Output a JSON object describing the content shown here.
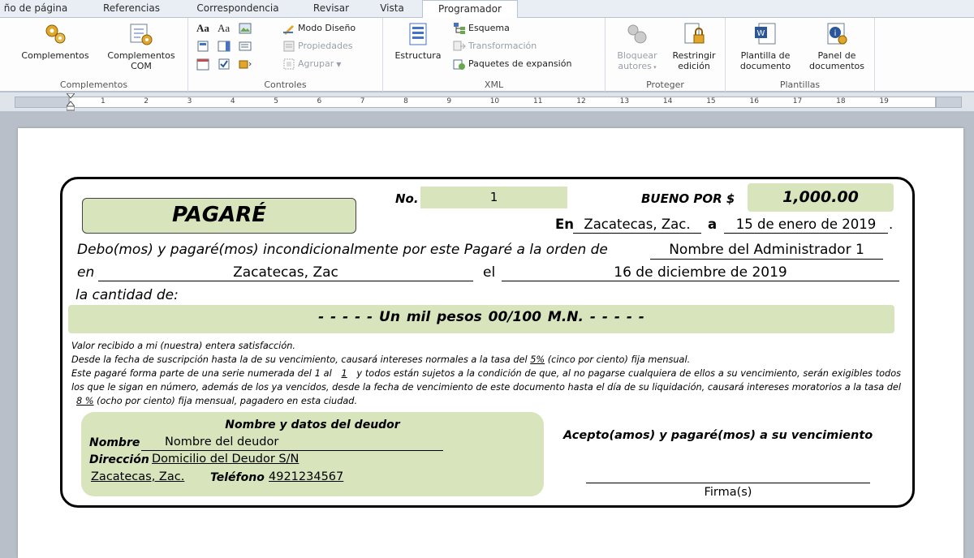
{
  "tabs": [
    "ño de página",
    "Referencias",
    "Correspondencia",
    "Revisar",
    "Vista",
    "Programador"
  ],
  "ribbon": {
    "complementos": {
      "btn1": "Complementos",
      "btn2a": "Complementos",
      "btn2b": "COM",
      "label": "Complementos"
    },
    "controles": {
      "modo": "Modo Diseño",
      "propiedades": "Propiedades",
      "agrupar": "Agrupar",
      "label": "Controles",
      "aa1": "Aa",
      "aa2": "Aa"
    },
    "xml": {
      "estructura": "Estructura",
      "esquema": "Esquema",
      "transformacion": "Transformación",
      "paquetes": "Paquetes de expansión",
      "label": "XML"
    },
    "proteger": {
      "bloquear_a": "Bloquear",
      "bloquear_b": "autores",
      "restringir_a": "Restringir",
      "restringir_b": "edición",
      "label": "Proteger"
    },
    "plantillas": {
      "plantilla_a": "Plantilla de",
      "plantilla_b": "documento",
      "panel_a": "Panel de",
      "panel_b": "documentos",
      "label": "Plantillas"
    }
  },
  "ruler": [
    "1",
    "2",
    "3",
    "4",
    "5",
    "6",
    "7",
    "8",
    "9",
    "10",
    "11",
    "12",
    "13",
    "14",
    "15",
    "16",
    "17",
    "18",
    "19"
  ],
  "doc": {
    "title": "PAGARÉ",
    "no_label": "No.",
    "no_value": "1",
    "bueno_label": "BUENO POR $",
    "amount": "1,000.00",
    "en_label": "En",
    "city": "Zacatecas, Zac.",
    "a_label": "a",
    "date": "15 de enero de 2019",
    "date_end": ".",
    "debo_text": "Debo(mos) y pagaré(mos) incondicionalmente por este Pagaré a la orden de",
    "payee": "Nombre del Administrador 1",
    "en2_label": "en",
    "place": "Zacatecas, Zac",
    "el_label": "el",
    "due_date": "16 de diciembre de 2019",
    "cantidad_label": "la cantidad de:",
    "amount_words": "- - - - - Un mil pesos 00/100 M.N. - - - - -",
    "p1": "Valor recibido a mi (nuestra) entera satisfacción.",
    "p2a": "Desde la fecha de suscripción hasta la de su vencimiento, causará intereses normales a la tasa del ",
    "p2b": "5%",
    "p2c": " (cinco por ciento) fija mensual.",
    "p3a": "Este pagaré forma parte de una serie numerada del 1 al ",
    "p3b": "1",
    "p3c": " y todos están sujetos a la condición de que, al no pagarse cualquiera de ellos a su vencimiento, serán exigibles todos los que le sigan en número, además de los ya vencidos, desde la fecha de vencimiento de este documento hasta el día de su liquidación, causará intereses moratorios a la tasa del ",
    "p3d": "8 %",
    "p3e": " (ocho por ciento) fija mensual, pagadero en esta ciudad.",
    "deudor_title": "Nombre y datos del deudor",
    "nombre_label": "Nombre",
    "nombre_value": "Nombre del deudor",
    "direccion_label": "Dirección",
    "direccion_value": "Domicilio del Deudor S/N",
    "ciudad_value": "Zacatecas, Zac.",
    "telefono_label": "Teléfono",
    "telefono_value": "4921234567",
    "acepto": "Acepto(amos) y pagaré(mos) a su vencimiento",
    "firma": "Firma(s)"
  }
}
